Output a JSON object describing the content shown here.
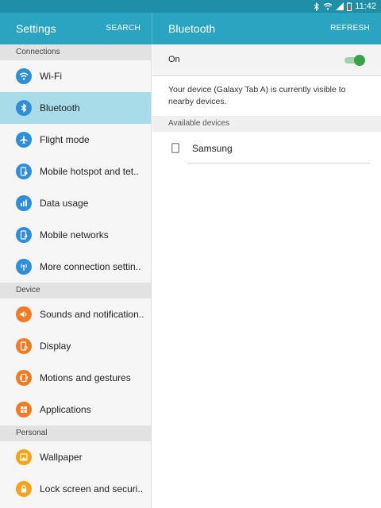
{
  "status_bar": {
    "time": "11:42"
  },
  "appbar": {
    "left_title": "Settings",
    "left_action": "SEARCH",
    "right_title": "Bluetooth",
    "right_action": "REFRESH"
  },
  "sidebar": {
    "sections": [
      {
        "header": "Connections",
        "items": [
          {
            "label": "Wi-Fi",
            "icon": "wifi-icon",
            "color": "#2e8fd8"
          },
          {
            "label": "Bluetooth",
            "icon": "bluetooth-icon",
            "color": "#2e8fd8",
            "selected": true
          },
          {
            "label": "Flight mode",
            "icon": "airplane-icon",
            "color": "#2e8fd8"
          },
          {
            "label": "Mobile hotspot and tet..",
            "icon": "hotspot-icon",
            "color": "#2e8fd8"
          },
          {
            "label": "Data usage",
            "icon": "data-usage-icon",
            "color": "#2e8fd8"
          },
          {
            "label": "Mobile networks",
            "icon": "mobile-network-icon",
            "color": "#2e8fd8"
          },
          {
            "label": "More connection settin..",
            "icon": "antenna-icon",
            "color": "#2e8fd8"
          }
        ]
      },
      {
        "header": "Device",
        "items": [
          {
            "label": "Sounds and notification..",
            "icon": "volume-icon",
            "color": "#ef7b22"
          },
          {
            "label": "Display",
            "icon": "display-icon",
            "color": "#ef7b22"
          },
          {
            "label": "Motions and gestures",
            "icon": "gesture-icon",
            "color": "#ef7b22"
          },
          {
            "label": "Applications",
            "icon": "apps-grid-icon",
            "color": "#ef7b22"
          }
        ]
      },
      {
        "header": "Personal",
        "items": [
          {
            "label": "Wallpaper",
            "icon": "wallpaper-icon",
            "color": "#f3a41a"
          },
          {
            "label": "Lock screen and securi..",
            "icon": "lock-icon",
            "color": "#f3a41a"
          }
        ]
      }
    ]
  },
  "main": {
    "toggle": {
      "label": "On",
      "state": "on"
    },
    "visibility_text": "Your device (Galaxy Tab A) is currently visible to nearby devices.",
    "available_header": "Available devices",
    "devices": [
      {
        "name": "Samsung",
        "icon": "tablet-icon"
      }
    ]
  }
}
